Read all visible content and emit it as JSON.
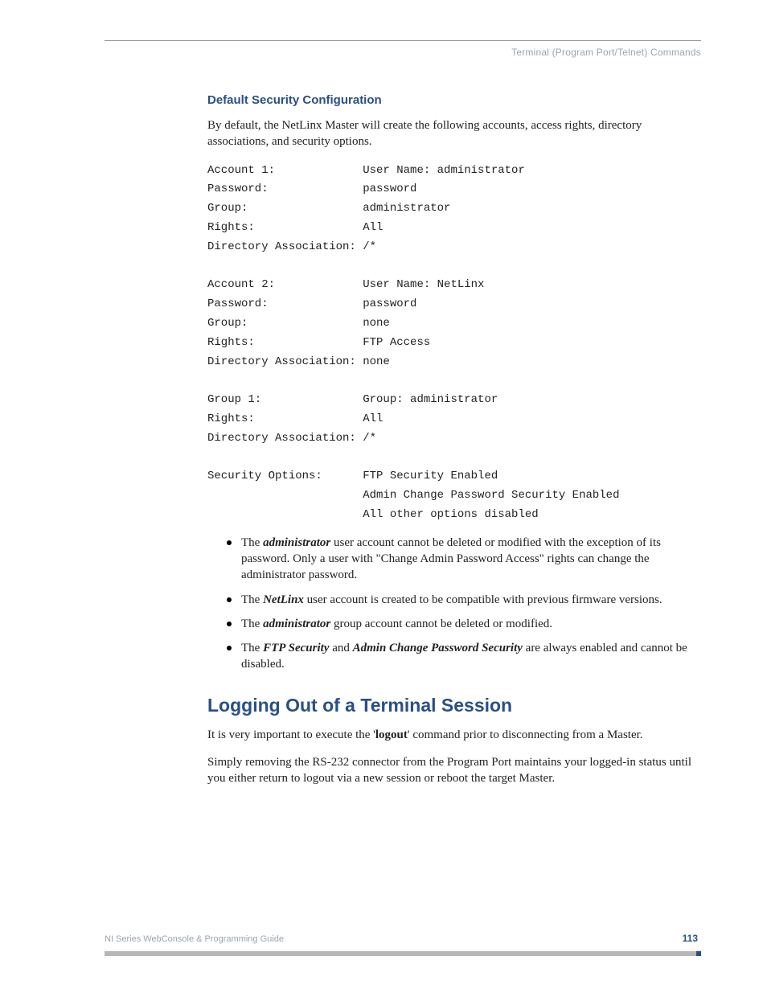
{
  "running_head": "Terminal (Program Port/Telnet) Commands",
  "section1": {
    "heading": "Default Security Configuration",
    "intro": "By default, the NetLinx Master will create the following accounts, access rights, directory associations, and security options.",
    "mono": "Account 1:             User Name: administrator\nPassword:              password\nGroup:                 administrator\nRights:                All\nDirectory Association: /*\n\nAccount 2:             User Name: NetLinx\nPassword:              password\nGroup:                 none\nRights:                FTP Access\nDirectory Association: none\n\nGroup 1:               Group: administrator\nRights:                All\nDirectory Association: /*\n\nSecurity Options:      FTP Security Enabled\n                       Admin Change Password Security Enabled\n                       All other options disabled",
    "bullets": {
      "b1_pre": "The ",
      "b1_label": "administrator",
      "b1_post": " user account cannot be deleted or modified with the exception of its password. Only a user with \"Change Admin Password Access\" rights can change the administrator password.",
      "b2_pre": "The ",
      "b2_label": "NetLinx",
      "b2_post": " user account is created to be compatible with previous firmware versions.",
      "b3_pre": "The ",
      "b3_label": "administrator",
      "b3_post": " group account cannot be deleted or modified.",
      "b4_pre": "The ",
      "b4_label1": "FTP Security",
      "b4_mid": " and ",
      "b4_label2": "Admin Change Password Security",
      "b4_post": " are always enabled and cannot be disabled."
    }
  },
  "section2": {
    "heading": "Logging Out of a Terminal Session",
    "p1_pre": "It is very important to execute the '",
    "p1_bold": "logout",
    "p1_post": "' command prior to disconnecting from a Master.",
    "p2": "Simply removing the RS-232 connector from the Program Port maintains your logged-in status until you either return to logout via a new session or reboot the target Master."
  },
  "footer": {
    "title": "NI Series WebConsole & Programming Guide",
    "page": "113"
  }
}
